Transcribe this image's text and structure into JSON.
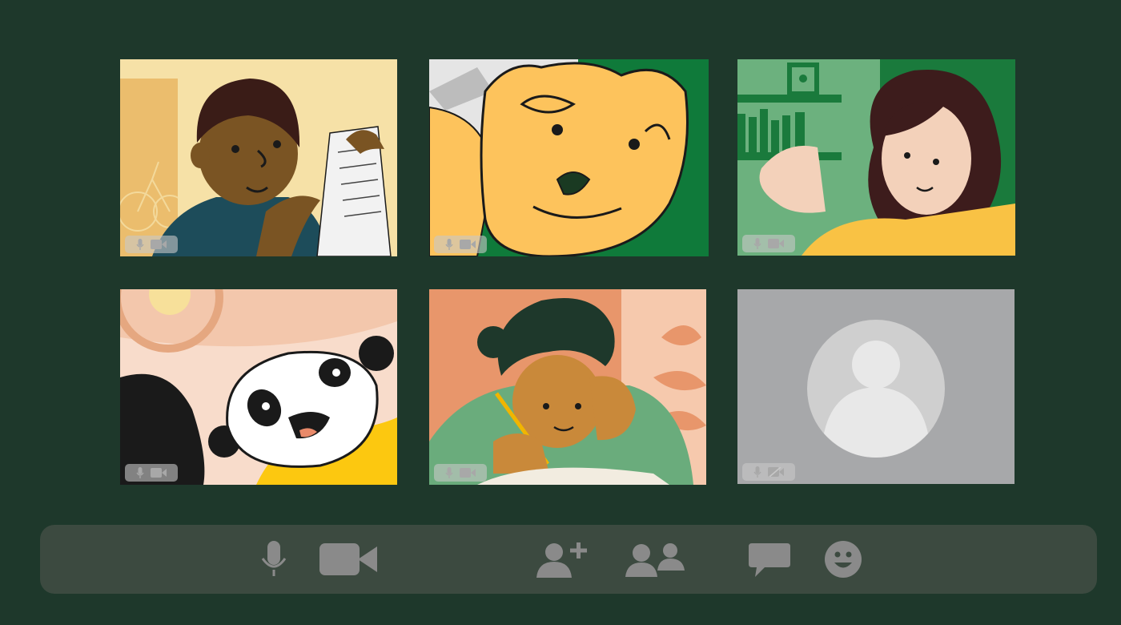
{
  "colors": {
    "background": "#1e382b",
    "toolbar_bg": "#3c4a40",
    "toolbar_icon": "#8a8a8a",
    "tile_status_bg": "#c8c8c8",
    "tile_status_icon": "#a8a8a8"
  },
  "participants": [
    {
      "tile": "person-with-paper",
      "mic_icon": "microphone-icon",
      "camera_icon": "video-camera-icon",
      "camera_on": true
    },
    {
      "tile": "bear",
      "mic_icon": "microphone-icon",
      "camera_icon": "video-camera-icon",
      "camera_on": true
    },
    {
      "tile": "woman-waving",
      "mic_icon": "microphone-icon",
      "camera_icon": "video-camera-icon",
      "camera_on": true
    },
    {
      "tile": "panda",
      "mic_icon": "microphone-icon",
      "camera_icon": "video-camera-icon",
      "camera_on": true
    },
    {
      "tile": "person-writing",
      "mic_icon": "microphone-icon",
      "camera_icon": "video-camera-icon",
      "camera_on": true
    },
    {
      "tile": "avatar-placeholder",
      "mic_icon": "microphone-icon",
      "camera_icon": "video-camera-off-icon",
      "camera_on": false
    }
  ],
  "toolbar": {
    "buttons": [
      {
        "icon": "microphone-icon"
      },
      {
        "icon": "video-camera-icon"
      },
      {
        "icon": "add-person-icon"
      },
      {
        "icon": "participants-icon"
      },
      {
        "icon": "chat-bubble-icon"
      },
      {
        "icon": "emoji-smile-icon"
      }
    ]
  }
}
